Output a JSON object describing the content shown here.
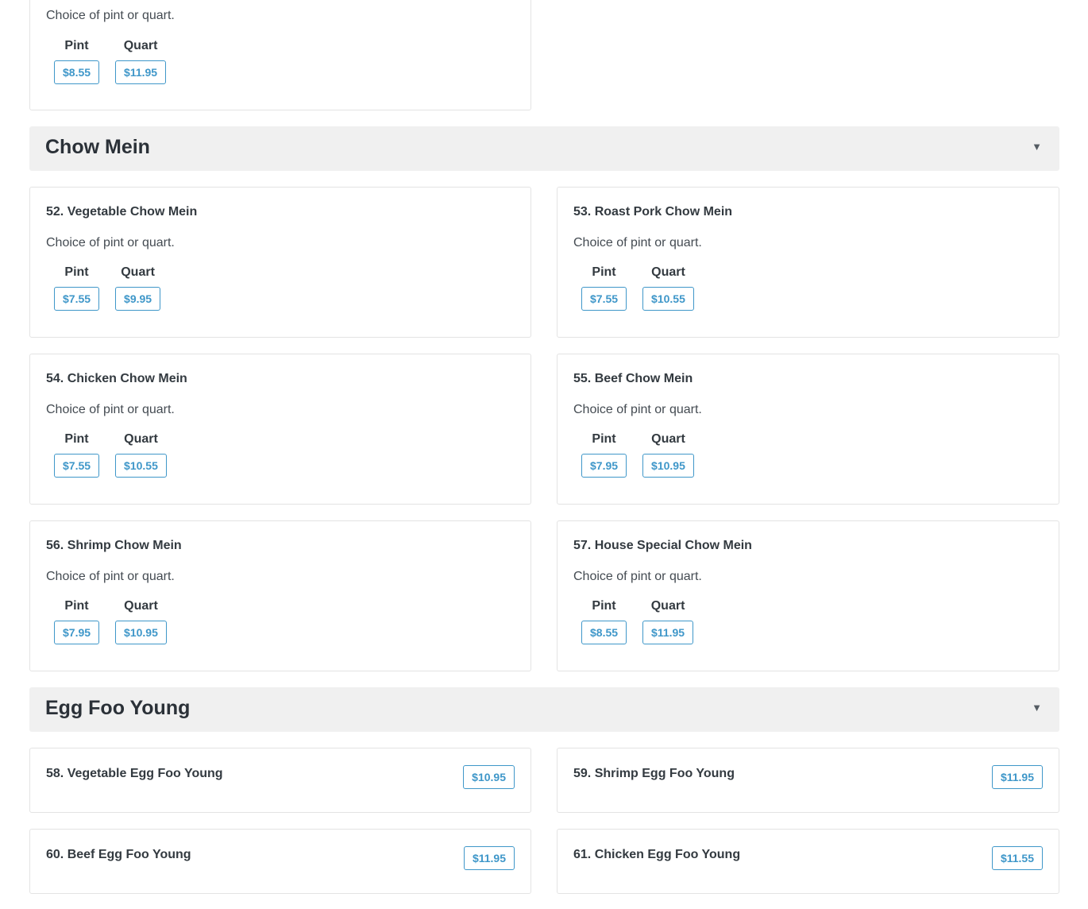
{
  "prev_item": {
    "description": "Choice of pint or quart.",
    "options": [
      {
        "label": "Pint",
        "price": "$8.55"
      },
      {
        "label": "Quart",
        "price": "$11.95"
      }
    ]
  },
  "sections": [
    {
      "title": "Chow Mein",
      "caret": "▼",
      "items": [
        {
          "name": "52. Vegetable Chow Mein",
          "description": "Choice of pint or quart.",
          "options": [
            {
              "label": "Pint",
              "price": "$7.55"
            },
            {
              "label": "Quart",
              "price": "$9.95"
            }
          ]
        },
        {
          "name": "53. Roast Pork Chow Mein",
          "description": "Choice of pint or quart.",
          "options": [
            {
              "label": "Pint",
              "price": "$7.55"
            },
            {
              "label": "Quart",
              "price": "$10.55"
            }
          ]
        },
        {
          "name": "54. Chicken Chow Mein",
          "description": "Choice of pint or quart.",
          "options": [
            {
              "label": "Pint",
              "price": "$7.55"
            },
            {
              "label": "Quart",
              "price": "$10.55"
            }
          ]
        },
        {
          "name": "55. Beef Chow Mein",
          "description": "Choice of pint or quart.",
          "options": [
            {
              "label": "Pint",
              "price": "$7.95"
            },
            {
              "label": "Quart",
              "price": "$10.95"
            }
          ]
        },
        {
          "name": "56. Shrimp Chow Mein",
          "description": "Choice of pint or quart.",
          "options": [
            {
              "label": "Pint",
              "price": "$7.95"
            },
            {
              "label": "Quart",
              "price": "$10.95"
            }
          ]
        },
        {
          "name": "57. House Special Chow Mein",
          "description": "Choice of pint or quart.",
          "options": [
            {
              "label": "Pint",
              "price": "$8.55"
            },
            {
              "label": "Quart",
              "price": "$11.95"
            }
          ]
        }
      ]
    },
    {
      "title": "Egg Foo Young",
      "caret": "▼",
      "items": [
        {
          "name": "58. Vegetable Egg Foo Young",
          "price": "$10.95"
        },
        {
          "name": "59. Shrimp Egg Foo Young",
          "price": "$11.95"
        },
        {
          "name": "60. Beef Egg Foo Young",
          "price": "$11.95"
        },
        {
          "name": "61. Chicken Egg Foo Young",
          "price": "$11.55"
        }
      ]
    }
  ]
}
